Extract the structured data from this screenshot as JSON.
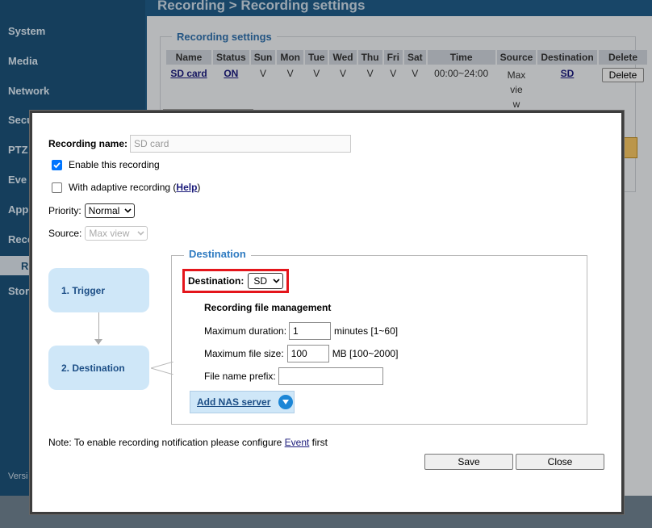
{
  "background": {
    "breadcrumb": "Recording  > Recording settings",
    "sidebar": {
      "items": [
        "System",
        "Media",
        "Network",
        "Secu",
        "PTZ",
        "Eve",
        "App",
        "Reco",
        "R",
        "Stor"
      ],
      "version": "Versi"
    },
    "recording_settings": {
      "legend": "Recording settings",
      "columns": [
        "Name",
        "Status",
        "Sun",
        "Mon",
        "Tue",
        "Wed",
        "Thu",
        "Fri",
        "Sat",
        "Time",
        "Source",
        "Destination",
        "Delete"
      ],
      "row": {
        "name": "SD card",
        "status": "ON",
        "sun": "V",
        "mon": "V",
        "tue": "V",
        "wed": "V",
        "thu": "V",
        "fri": "V",
        "sat": "V",
        "time": "00:00~24:00",
        "source": "Max vie\nw",
        "destination": "SD",
        "delete": "Delete"
      }
    }
  },
  "dialog": {
    "recording_name_label": "Recording name:",
    "recording_name_value": "SD card",
    "enable_label": "Enable this recording",
    "enable_checked": true,
    "adaptive_label": "With adaptive recording (",
    "adaptive_help": "Help",
    "adaptive_close": ")",
    "adaptive_checked": false,
    "priority_label": "Priority:",
    "priority_value": "Normal",
    "source_label": "Source:",
    "source_value": "Max view",
    "steps": [
      {
        "label": "1.  Trigger"
      },
      {
        "label": "2.  Destination"
      }
    ],
    "destination": {
      "legend": "Destination",
      "destination_label": "Destination:",
      "destination_value": "SD",
      "file_mgmt_title": "Recording file management",
      "max_duration_label": "Maximum duration:",
      "max_duration_value": "1",
      "max_duration_unit": "minutes [1~60]",
      "max_file_size_label": "Maximum file size:",
      "max_file_size_value": "100",
      "max_file_size_unit": "MB [100~2000]",
      "prefix_label": "File name prefix:",
      "prefix_value": "",
      "add_nas_label": "Add NAS server"
    },
    "note_prefix": "Note: To enable recording notification please configure ",
    "note_link": "Event",
    "note_suffix": " first",
    "save_label": "Save",
    "close_label": "Close"
  },
  "colors": {
    "sidebar": "#1b5077",
    "step_fill": "#cfe7f8",
    "highlight": "#e4151b",
    "legend_blue": "#2f7bc1"
  }
}
